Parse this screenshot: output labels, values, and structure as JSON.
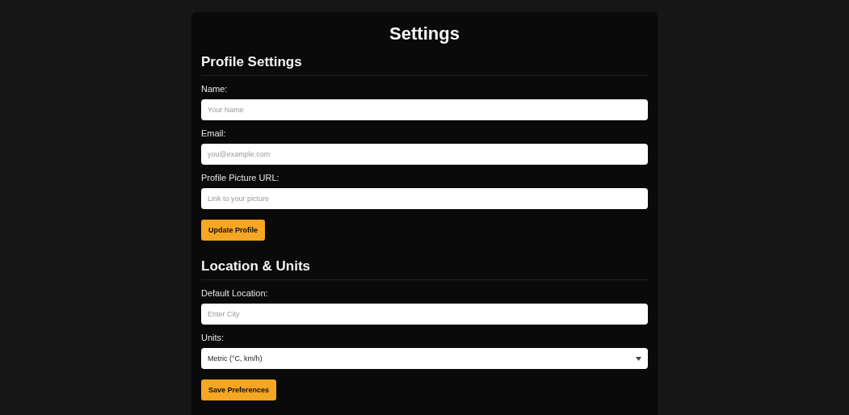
{
  "title": "Settings",
  "sections": [
    {
      "heading": "Profile Settings",
      "fields": [
        {
          "kind": "text",
          "label": "Name:",
          "placeholder": "Your Name"
        },
        {
          "kind": "text",
          "label": "Email:",
          "placeholder": "you@example.com"
        },
        {
          "kind": "text",
          "label": "Profile Picture URL:",
          "placeholder": "Link to your picture"
        }
      ],
      "button": "Update Profile"
    },
    {
      "heading": "Location & Units",
      "fields": [
        {
          "kind": "text",
          "label": "Default Location:",
          "placeholder": "Enter City"
        },
        {
          "kind": "select",
          "label": "Units:",
          "value": "Metric (°C, km/h)"
        }
      ],
      "button": "Save Preferences"
    }
  ]
}
